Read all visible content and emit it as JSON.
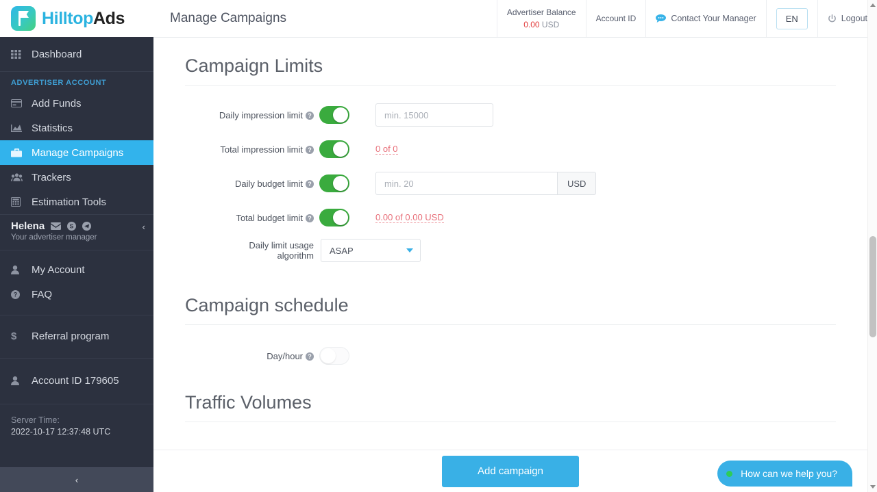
{
  "brand": {
    "name_part1": "Hilltop",
    "name_part2": "Ads",
    "logo_icon": "flag-icon",
    "accent": "#39b0e6",
    "green": "#3aab3e"
  },
  "sidebar": {
    "dashboard": {
      "label": "Dashboard",
      "icon": "grid-icon"
    },
    "section_title": "ADVERTISER ACCOUNT",
    "items": [
      {
        "label": "Add Funds",
        "icon": "credit-card-icon"
      },
      {
        "label": "Statistics",
        "icon": "area-chart-icon"
      },
      {
        "label": "Manage Campaigns",
        "icon": "briefcase-icon"
      },
      {
        "label": "Trackers",
        "icon": "users-icon"
      },
      {
        "label": "Estimation Tools",
        "icon": "calculator-icon"
      }
    ],
    "manager": {
      "name": "Helena",
      "subtitle": "Your advertiser manager",
      "icons": [
        "envelope-icon",
        "skype-icon",
        "telegram-icon"
      ],
      "collapse": "‹"
    },
    "account_items": [
      {
        "label": "My Account",
        "icon": "user-icon"
      },
      {
        "label": "FAQ",
        "icon": "question-circle-icon"
      }
    ],
    "referral": {
      "label": "Referral program",
      "icon": "dollar-icon"
    },
    "account_id": {
      "label": "Account ID 179605",
      "icon": "user-icon"
    },
    "server_time_label": "Server Time:",
    "server_time_value": "2022-10-17 12:37:48 UTC",
    "collapse_bar": "‹"
  },
  "header": {
    "title": "Manage Campaigns",
    "balance_label": "Advertiser Balance",
    "balance_amount": "0.00",
    "balance_currency": "USD",
    "account_id_label": "Account ID",
    "contact_label": "Contact Your Manager",
    "contact_icon": "chat-bubble-icon",
    "language": "EN",
    "logout_label": "Logout",
    "logout_icon": "power-icon"
  },
  "main": {
    "sections": {
      "limits_title": "Campaign Limits",
      "schedule_title": "Campaign schedule",
      "traffic_title": "Traffic Volumes"
    },
    "rows": {
      "daily_impression": {
        "label": "Daily impression limit",
        "toggle": "on",
        "placeholder": "min. 15000",
        "value": ""
      },
      "total_impression": {
        "label": "Total impression limit",
        "toggle": "on",
        "value_text": "0 of 0"
      },
      "daily_budget": {
        "label": "Daily budget limit",
        "toggle": "on",
        "placeholder": "min. 20",
        "value": "",
        "addon": "USD"
      },
      "total_budget": {
        "label": "Total budget limit",
        "toggle": "on",
        "value_text": "0.00 of 0.00 USD"
      },
      "algorithm": {
        "label_line1": "Daily limit usage",
        "label_line2": "algorithm",
        "selected": "ASAP"
      },
      "day_hour": {
        "label": "Day/hour",
        "toggle": "off"
      }
    },
    "help_glyph": "?"
  },
  "footer": {
    "submit_label": "Add campaign",
    "chat_label": "How can we help you?"
  }
}
